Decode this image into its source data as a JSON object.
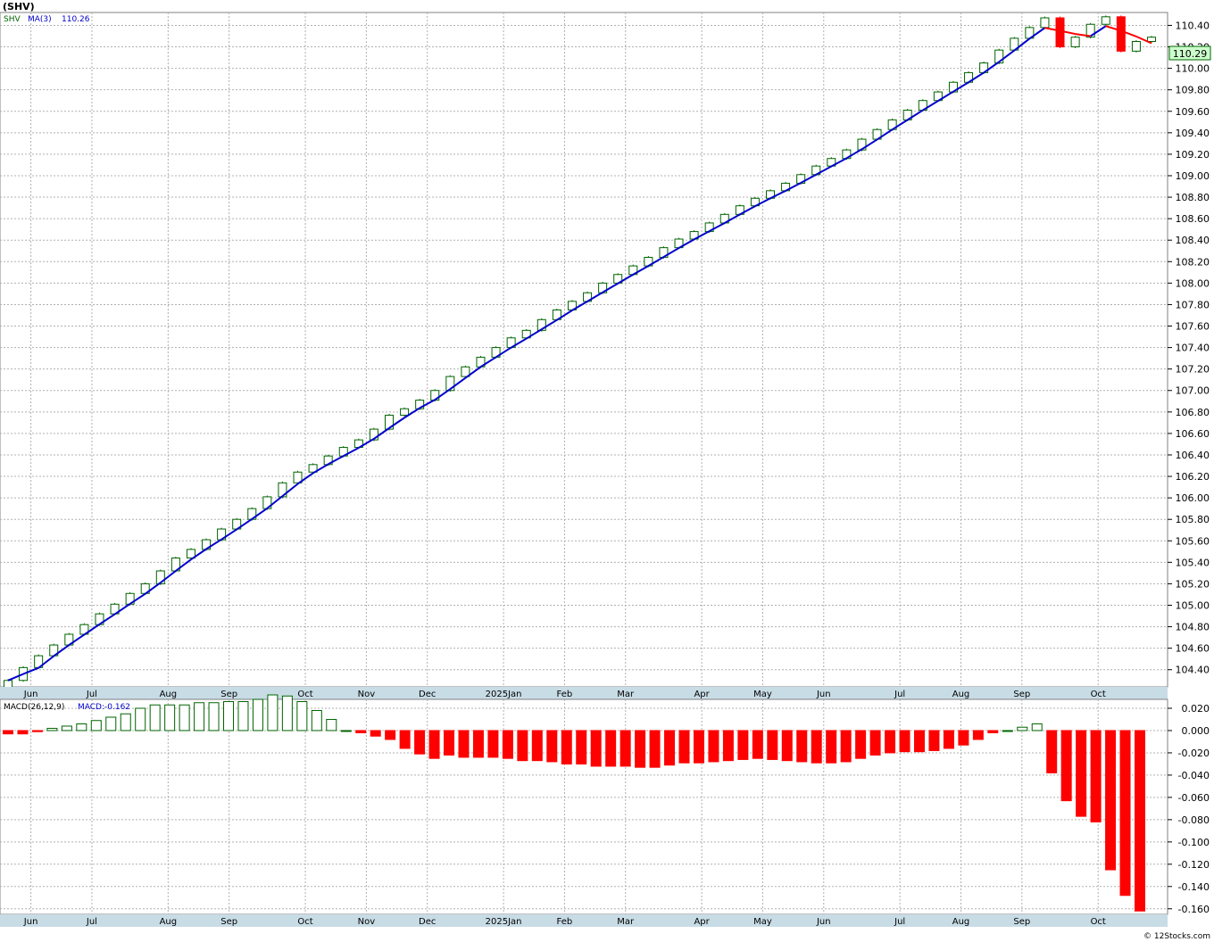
{
  "page": {
    "title": "(SHV)",
    "footer": "© 12Stocks.com"
  },
  "price_legend": {
    "symbol": "SHV",
    "ma_label": "MA(3)",
    "ma_value": "110.26",
    "last_price": "110.29"
  },
  "macd_legend": {
    "label": "MACD(26,12,9)",
    "value": "MACD:-0.162"
  },
  "colors": {
    "up_candle": "#006400",
    "down_candle": "#ff0000",
    "ma_up": "#0000cc",
    "ma_down": "#ff0000",
    "macd_pos": "#006400",
    "macd_neg": "#ff0000",
    "axis_band": "#c8dce6",
    "price_box": "#ccffcc"
  },
  "chart_data": [
    {
      "type": "candlestick",
      "title": "(SHV)",
      "ylim": [
        104.24,
        110.52
      ],
      "y_ticks": [
        "104.40",
        "104.60",
        "104.80",
        "105.00",
        "105.20",
        "105.40",
        "105.60",
        "105.80",
        "106.00",
        "106.20",
        "106.40",
        "106.60",
        "106.80",
        "107.00",
        "107.20",
        "107.40",
        "107.60",
        "107.80",
        "108.00",
        "108.20",
        "108.40",
        "108.60",
        "108.80",
        "109.00",
        "109.20",
        "109.40",
        "109.60",
        "109.80",
        "110.00",
        "110.20",
        "110.40"
      ],
      "x_labels": [
        "Jun",
        "Jul",
        "Aug",
        "Sep",
        "Oct",
        "Nov",
        "Dec",
        "2025Jan",
        "Feb",
        "Mar",
        "Apr",
        "May",
        "Jun",
        "Jul",
        "Aug",
        "Sep",
        "Oct"
      ],
      "x_label_index": [
        1,
        5,
        10,
        14,
        19,
        23,
        27,
        32,
        36,
        40,
        45,
        49,
        53,
        58,
        62,
        66,
        71
      ],
      "grid": true,
      "closes": [
        104.3,
        104.42,
        104.53,
        104.63,
        104.73,
        104.82,
        104.92,
        105.01,
        105.11,
        105.2,
        105.32,
        105.44,
        105.52,
        105.61,
        105.71,
        105.8,
        105.9,
        106.01,
        106.14,
        106.24,
        106.31,
        106.39,
        106.47,
        106.54,
        106.64,
        106.77,
        106.83,
        106.91,
        107.0,
        107.13,
        107.22,
        107.31,
        107.4,
        107.49,
        107.56,
        107.66,
        107.75,
        107.83,
        107.91,
        108.0,
        108.08,
        108.16,
        108.24,
        108.33,
        108.41,
        108.48,
        108.56,
        108.64,
        108.72,
        108.79,
        108.86,
        108.93,
        109.01,
        109.09,
        109.16,
        109.24,
        109.34,
        109.43,
        109.52,
        109.61,
        109.7,
        109.78,
        109.87,
        109.96,
        110.05,
        110.17,
        110.28,
        110.38,
        110.47,
        110.2,
        110.29,
        110.41,
        110.48,
        110.16,
        110.25,
        110.29
      ],
      "series": [
        {
          "name": "MA(3)",
          "last": 110.26
        }
      ]
    },
    {
      "type": "bar",
      "title": "MACD(26,12,9)",
      "ylim": [
        -0.165,
        0.028
      ],
      "y_ticks": [
        "0.020",
        "0.000",
        "-0.020",
        "-0.040",
        "-0.060",
        "-0.080",
        "-0.100",
        "-0.120",
        "-0.140",
        "-0.160"
      ],
      "values": [
        -0.003,
        -0.003,
        -0.001,
        0.002,
        0.004,
        0.006,
        0.009,
        0.012,
        0.015,
        0.02,
        0.023,
        0.023,
        0.023,
        0.025,
        0.025,
        0.026,
        0.026,
        0.028,
        0.032,
        0.031,
        0.026,
        0.018,
        0.01,
        0.0,
        -0.002,
        -0.005,
        -0.008,
        -0.016,
        -0.021,
        -0.025,
        -0.022,
        -0.024,
        -0.024,
        -0.024,
        -0.025,
        -0.027,
        -0.027,
        -0.028,
        -0.03,
        -0.03,
        -0.032,
        -0.032,
        -0.032,
        -0.033,
        -0.033,
        -0.031,
        -0.029,
        -0.029,
        -0.028,
        -0.027,
        -0.026,
        -0.025,
        -0.026,
        -0.027,
        -0.028,
        -0.029,
        -0.029,
        -0.028,
        -0.025,
        -0.022,
        -0.02,
        -0.019,
        -0.019,
        -0.018,
        -0.016,
        -0.013,
        -0.008,
        -0.002,
        0.0,
        0.003,
        0.006,
        -0.038,
        -0.063,
        -0.077,
        -0.082,
        -0.125,
        -0.148,
        -0.162
      ]
    }
  ]
}
